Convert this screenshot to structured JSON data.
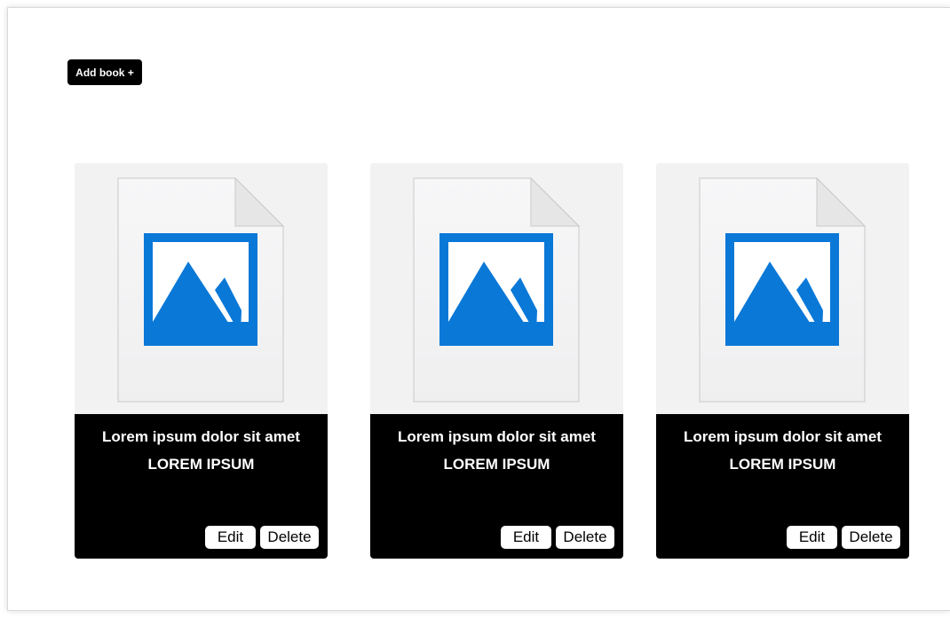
{
  "toolbar": {
    "add_book_label": "Add book +"
  },
  "colors": {
    "card_body_bg": "#000000",
    "card_image_bg": "#f2f2f2",
    "placeholder_blue": "#0a78d7"
  },
  "books": [
    {
      "title": "Lorem ipsum dolor sit amet",
      "subtitle": "LOREM IPSUM",
      "image_icon": "image-placeholder-icon",
      "edit_label": "Edit",
      "delete_label": "Delete"
    },
    {
      "title": "Lorem ipsum dolor sit amet",
      "subtitle": "LOREM IPSUM",
      "image_icon": "image-placeholder-icon",
      "edit_label": "Edit",
      "delete_label": "Delete"
    },
    {
      "title": "Lorem ipsum dolor sit amet",
      "subtitle": "LOREM IPSUM",
      "image_icon": "image-placeholder-icon",
      "edit_label": "Edit",
      "delete_label": "Delete"
    }
  ]
}
